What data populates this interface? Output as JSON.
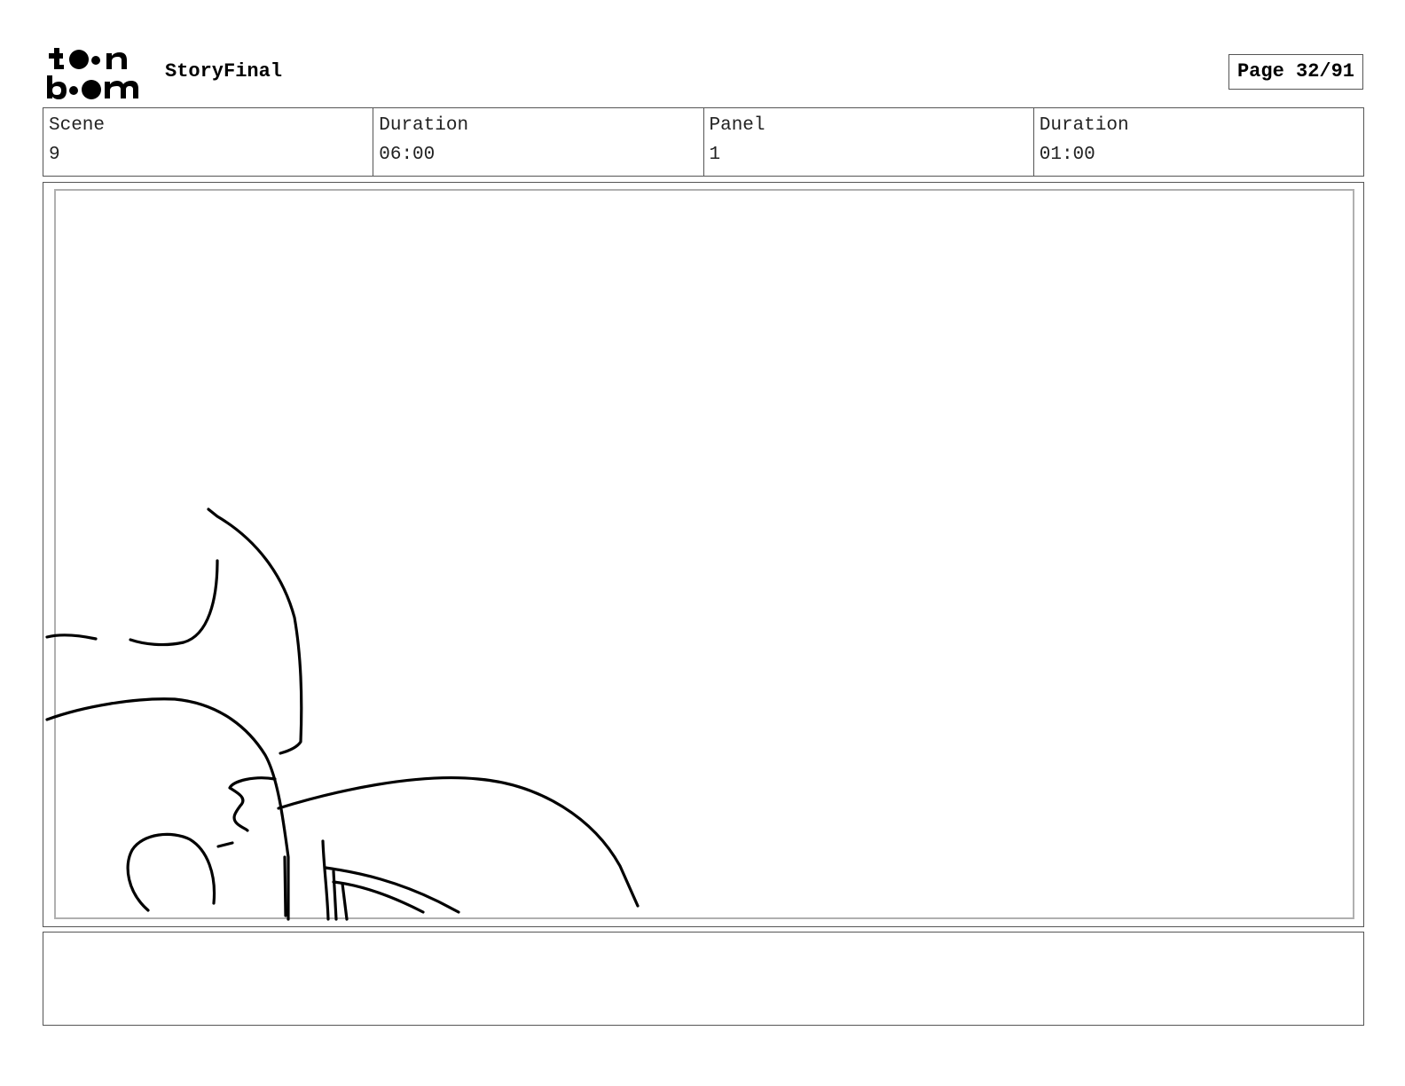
{
  "header": {
    "logo_text": [
      "to",
      "on",
      "bo",
      "om"
    ],
    "project_title": "StoryFinal",
    "page_indicator": "Page 32/91"
  },
  "info": {
    "scene_label": "Scene",
    "scene_value": "9",
    "scene_duration_label": "Duration",
    "scene_duration_value": "06:00",
    "panel_label": "Panel",
    "panel_value": "1",
    "panel_duration_label": "Duration",
    "panel_duration_value": "01:00"
  },
  "panel": {
    "drawing_content": "rough pencil sketch in the lower-left corner",
    "ink_color": "#000000"
  },
  "notes": {
    "text": ""
  }
}
